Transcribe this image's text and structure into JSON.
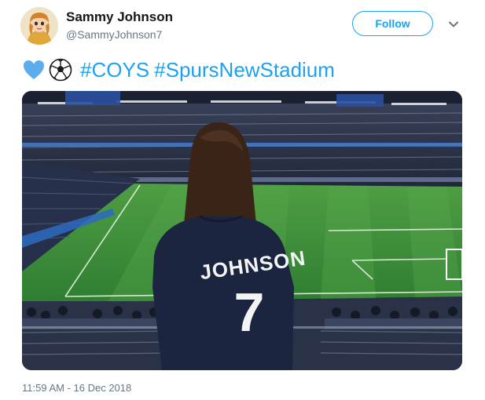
{
  "author": {
    "name": "Sammy Johnson",
    "handle": "@SammyJohnson7"
  },
  "actions": {
    "follow_label": "Follow",
    "menu_icon": "chevron-down-icon"
  },
  "tweet": {
    "emojis": [
      "blue-heart-icon",
      "soccer-ball-icon"
    ],
    "hashtags": [
      "#COYS",
      "#SpursNewStadium"
    ]
  },
  "photo": {
    "jersey_name": "JOHNSON",
    "jersey_number": "7"
  },
  "meta": {
    "timestamp": "11:59 AM - 16 Dec 2018"
  },
  "colors": {
    "accent": "#1da1f2",
    "secondary_text": "#657786",
    "pitch_green": "#3b8f3b",
    "jersey_navy": "#1c2540"
  }
}
